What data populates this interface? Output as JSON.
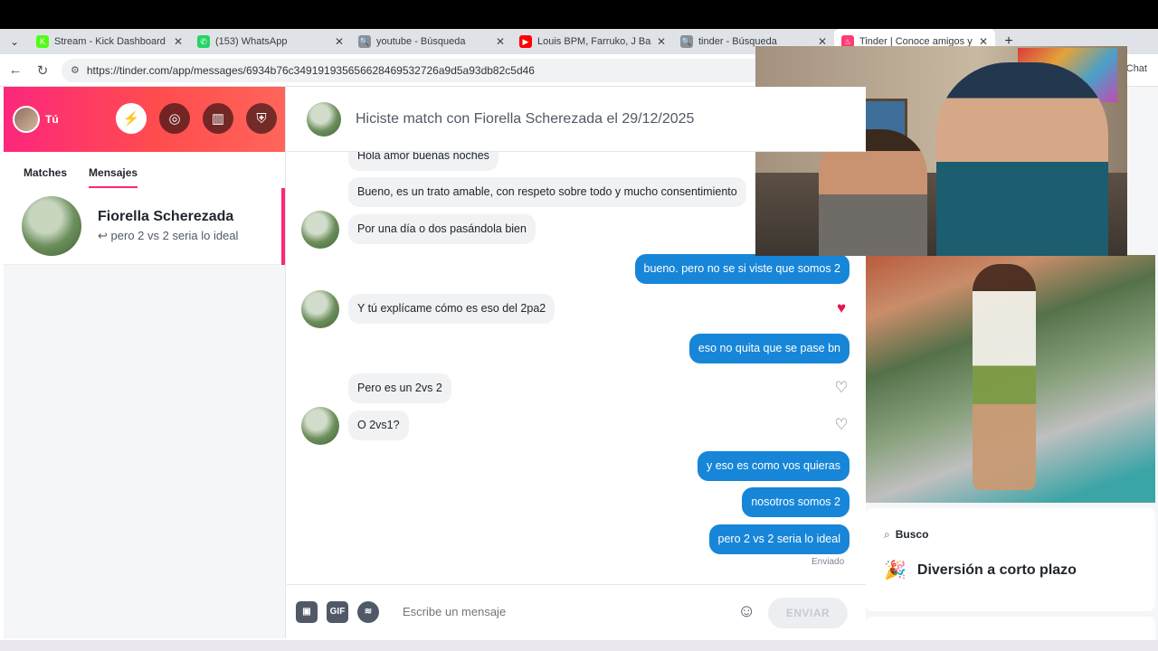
{
  "browser": {
    "tabs": [
      {
        "title": "Stream - Kick Dashboard",
        "favicon_color": "#53fc18",
        "favicon_glyph": "K",
        "active": false
      },
      {
        "title": "(153) WhatsApp",
        "favicon_color": "#25d366",
        "favicon_glyph": "✆",
        "active": false
      },
      {
        "title": "youtube - Búsqueda",
        "favicon_color": "#8a8f98",
        "favicon_glyph": "🔍",
        "active": false
      },
      {
        "title": "Louis BPM, Farruko, J Bal",
        "favicon_color": "#ff0000",
        "favicon_glyph": "▶",
        "active": false
      },
      {
        "title": "tinder - Búsqueda",
        "favicon_color": "#8a8f98",
        "favicon_glyph": "🔍",
        "active": false
      },
      {
        "title": "Tinder | Conoce amigos y ge",
        "favicon_color": "#fe3c72",
        "favicon_glyph": "♨",
        "active": true
      }
    ],
    "url": "https://tinder.com/app/messages/6934b76c349191935656628469532726a9d5a93db82c5d46",
    "right_label": "Chat"
  },
  "sidebar": {
    "user_name": "Tú",
    "tabs": [
      {
        "label": "Matches",
        "active": false
      },
      {
        "label": "Mensajes",
        "active": true
      }
    ],
    "conversation": {
      "name": "Fiorella Scherezada",
      "last_message": "pero 2 vs 2 seria lo ideal",
      "reply_glyph": "↩"
    }
  },
  "chat": {
    "header": "Hiciste match con Fiorella Scherezada el 29/12/2025",
    "messages": [
      {
        "dir": "in",
        "text": "Hola amor buenas noches",
        "avatar": false,
        "heart": null
      },
      {
        "dir": "in",
        "text": "Bueno, es un trato amable, con respeto sobre todo y mucho consentimiento",
        "avatar": false,
        "heart": null
      },
      {
        "dir": "in",
        "text": "Por una día o dos pasándola bien",
        "avatar": true,
        "heart": null
      },
      {
        "dir": "out",
        "text": "bueno. pero no se si viste que somos 2"
      },
      {
        "dir": "in",
        "text": "Y tú explícame cómo es eso del 2pa2",
        "avatar": true,
        "heart": "liked"
      },
      {
        "dir": "out",
        "text": "eso no quita que se pase bn"
      },
      {
        "dir": "in",
        "text": "Pero es un 2vs 2",
        "avatar": false,
        "heart": "empty"
      },
      {
        "dir": "in",
        "text": "O 2vs1?",
        "avatar": true,
        "heart": "empty"
      },
      {
        "dir": "out",
        "text": "y eso es como vos quieras"
      },
      {
        "dir": "out",
        "text": "nosotros somos 2"
      },
      {
        "dir": "out",
        "text": "pero 2 vs 2 seria lo ideal"
      }
    ],
    "sent_status": "Enviado",
    "composer": {
      "placeholder": "Escribe un mensaje",
      "gif_label": "GIF",
      "send_label": "ENVIAR"
    },
    "colors": {
      "outgoing": "#1786d8",
      "incoming": "#f0f2f4",
      "brand": "#fd267d",
      "heart": "#e8134f"
    }
  },
  "profile": {
    "busco_label": "Busco",
    "busco_value": "Diversión a corto plazo",
    "busco_emoji": "🎉"
  }
}
